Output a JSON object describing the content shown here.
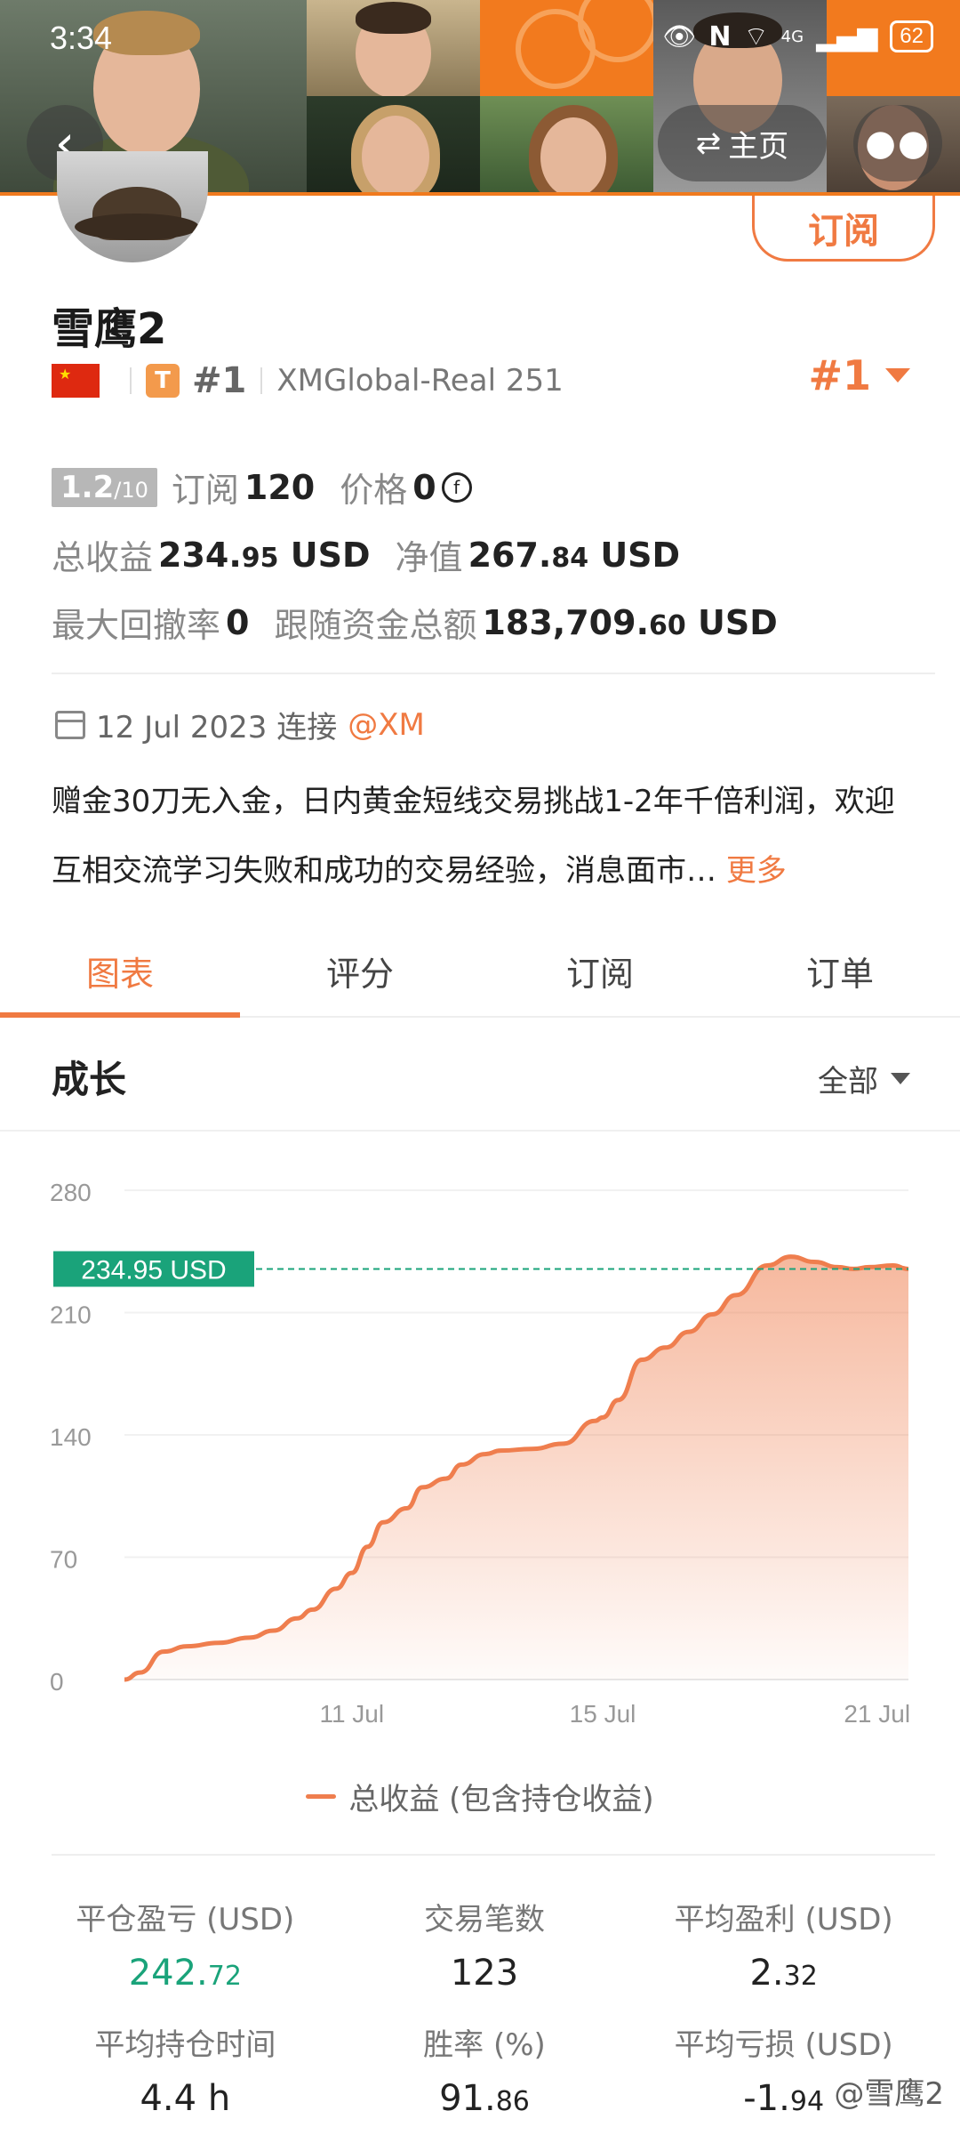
{
  "status_bar": {
    "time": "3:34",
    "network": "4G",
    "battery": "62"
  },
  "header": {
    "home_label": "主页",
    "subscribe_label": "订阅"
  },
  "profile": {
    "name": "雪鹰2",
    "type_badge": "T",
    "rank": "#1",
    "broker": "XMGlobal-Real 251",
    "rank_right": "#1",
    "rating_main": "1.2",
    "rating_max": "/10",
    "subscriptions_label": "订阅",
    "subscriptions_value": "120",
    "price_label": "价格",
    "price_value": "0",
    "total_profit_label": "总收益",
    "total_profit_main": "234.",
    "total_profit_dec": "95",
    "total_profit_unit": "USD",
    "equity_label": "净值",
    "equity_main": "267.",
    "equity_dec": "84",
    "equity_unit": "USD",
    "max_drawdown_label": "最大回撤率",
    "max_drawdown_value": "0",
    "follow_funds_label": "跟随资金总额",
    "follow_funds_main": "183,709.",
    "follow_funds_dec": "60",
    "follow_funds_unit": "USD",
    "joined_date": "12 Jul 2023 连接",
    "joined_broker": "@XM",
    "description": "赠金30刀无入金，日内黄金短线交易挑战1-2年千倍利润，欢迎互相交流学习失败和成功的交易经验，消息面市…",
    "more_link": "更多"
  },
  "tabs": [
    {
      "label": "图表",
      "active": true
    },
    {
      "label": "评分",
      "active": false
    },
    {
      "label": "订阅",
      "active": false
    },
    {
      "label": "订单",
      "active": false
    }
  ],
  "growth": {
    "title": "成长",
    "filter_label": "全部"
  },
  "chart_data": {
    "type": "area",
    "title": "",
    "xlabel": "",
    "ylabel": "",
    "ylim": [
      0,
      280
    ],
    "yticks": [
      "280",
      "210",
      "140",
      "70",
      "0"
    ],
    "xticks": [
      {
        "label": "11 Jul",
        "x": 0.29
      },
      {
        "label": "15 Jul",
        "x": 0.61
      },
      {
        "label": "21 Jul",
        "x": 0.96
      }
    ],
    "current_value_label": "234.95 USD",
    "current_value": 234.95,
    "series": [
      {
        "name": "总收益 (包含持仓收益)",
        "color": "#ef7e4e",
        "x": [
          0,
          0.02,
          0.05,
          0.08,
          0.12,
          0.16,
          0.19,
          0.22,
          0.24,
          0.27,
          0.29,
          0.31,
          0.33,
          0.36,
          0.38,
          0.41,
          0.43,
          0.46,
          0.48,
          0.52,
          0.56,
          0.6,
          0.61,
          0.63,
          0.66,
          0.69,
          0.72,
          0.75,
          0.78,
          0.82,
          0.85,
          0.88,
          0.91,
          0.93,
          0.95,
          0.98,
          1.0
        ],
        "values": [
          0,
          4,
          16,
          19,
          21,
          24,
          28,
          35,
          40,
          52,
          61,
          76,
          90,
          98,
          110,
          115,
          123,
          129,
          131,
          132,
          135,
          148,
          150,
          160,
          183,
          190,
          199,
          209,
          220,
          237,
          242,
          239,
          236,
          235,
          236,
          237,
          234.95
        ]
      }
    ]
  },
  "metrics": [
    {
      "label": "平仓盈亏 (USD)",
      "main": "242.",
      "dec": "72",
      "color": "#1aa37a"
    },
    {
      "label": "交易笔数",
      "main": "123",
      "dec": "",
      "color": "#222222"
    },
    {
      "label": "平均盈利 (USD)",
      "main": "2.",
      "dec": "32",
      "color": "#222222"
    },
    {
      "label": "平均持仓时间",
      "main": "4.4 h",
      "dec": "",
      "color": "#222222"
    },
    {
      "label": "胜率 (%)",
      "main": "91.",
      "dec": "86",
      "color": "#222222"
    },
    {
      "label": "平均亏损 (USD)",
      "main": "-1.",
      "dec": "94",
      "color": "#222222"
    }
  ],
  "watermark": "@雪鹰2",
  "colors": {
    "accent": "#f07a42",
    "banner": "#f39a4c",
    "profit_green": "#1aa37a",
    "line": "#ef7e4e",
    "current_tag": "#1aa37a"
  }
}
